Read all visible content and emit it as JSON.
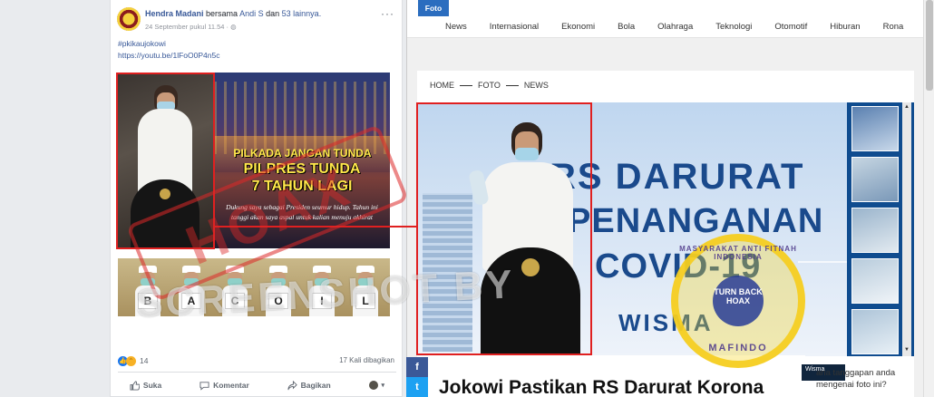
{
  "facebook": {
    "author": "Hendra Madani",
    "with_text": "bersama",
    "with_person": "Andi S",
    "and_text": "dan",
    "others": "53 lainnya.",
    "date": "24 September pukul 11.54 ·",
    "hashtag": "#pkikaujokowi",
    "link": "https://youtu.be/1lFoO0P4n5c",
    "image_text": {
      "line1": "PILKADA JANGAN TUNDA",
      "line2": "PILPRES TUNDA",
      "line3": "7 TAHUN LAGI",
      "line4": "Dukung saya sebagai Presiden seumur hidup. Tahun ini tanggi akan saya aspal untuk kalian menuju akhirat"
    },
    "nurse_signs": [
      "B",
      "A",
      "C",
      "O",
      "I",
      "L"
    ],
    "reaction_count": "14",
    "shares": "17 Kali dibagikan",
    "actions": {
      "like": "Suka",
      "comment": "Komentar",
      "share": "Bagikan"
    }
  },
  "watermark": {
    "stamp": "HOAX",
    "screenshot_text": "SCREENSHOT BY"
  },
  "site": {
    "section_tab": "Foto",
    "nav": [
      "News",
      "Internasional",
      "Ekonomi",
      "Bola",
      "Olahraga",
      "Teknologi",
      "Otomotif",
      "Hiburan",
      "Rona"
    ],
    "breadcrumb": [
      "HOME",
      "FOTO",
      "NEWS"
    ],
    "hero_text": {
      "line1": "RS DARURAT",
      "line2": "PENANGANAN",
      "line3": "COVID-19",
      "line4": "WISMA"
    },
    "caption_chip": "Wisma",
    "headline": "Jokowi Pastikan RS Darurat Korona",
    "side_question": "ana tanggapan anda mengenai foto ini?"
  },
  "badge": {
    "arc": "MASYARAKAT ANTI FITNAH INDONESIA",
    "inner": "TURN BACK HOAX",
    "bottom": "MAFINDO"
  },
  "colors": {
    "fb_link": "#385898",
    "highlight": "#e02020",
    "site_accent": "#2b6dbf",
    "hero_text": "#1a4a8c"
  }
}
